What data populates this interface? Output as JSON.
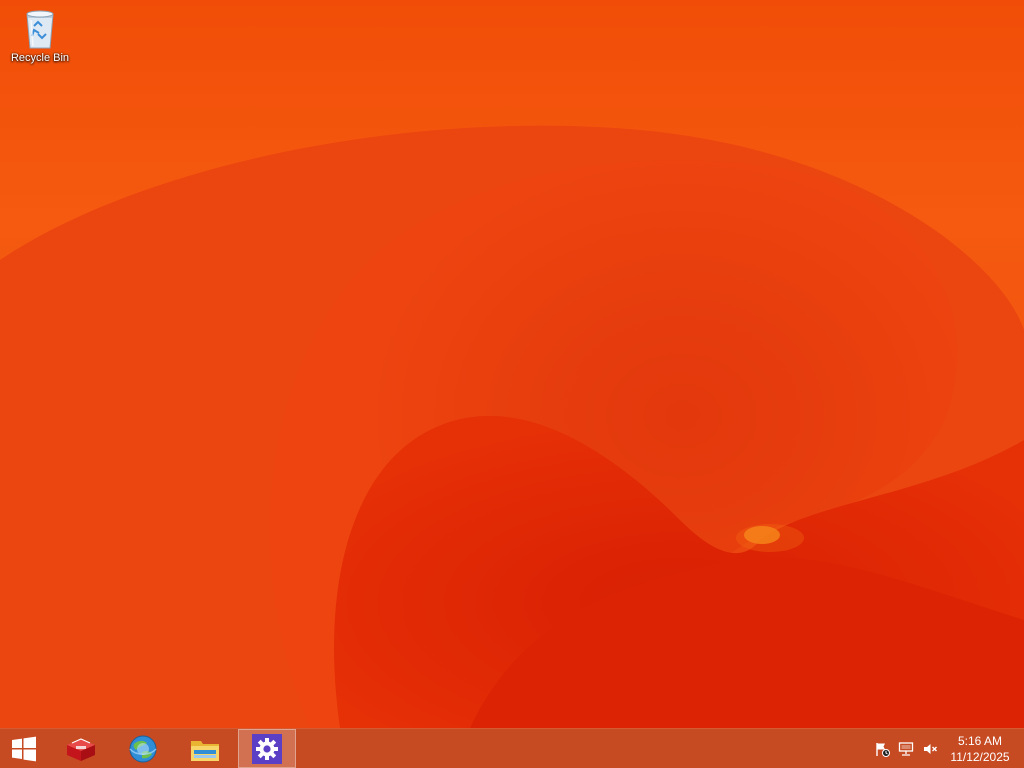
{
  "desktop": {
    "wallpaper_color": "#ef4a0a",
    "icons": [
      {
        "label": "Recycle Bin",
        "icon": "recycle-bin-icon"
      }
    ]
  },
  "taskbar": {
    "color": "#c64a22",
    "start": {
      "icon": "windows-logo-icon"
    },
    "pinned": [
      {
        "icon": "toolbox-app-icon",
        "active": false
      },
      {
        "icon": "globe-browser-icon",
        "active": false
      },
      {
        "icon": "file-explorer-icon",
        "active": false
      },
      {
        "icon": "settings-gear-icon",
        "active": true
      }
    ],
    "tray": {
      "icons": [
        "action-center-flag-icon",
        "network-icon",
        "volume-muted-icon"
      ],
      "time": "5:16 AM",
      "date": "11/12/2025"
    }
  }
}
